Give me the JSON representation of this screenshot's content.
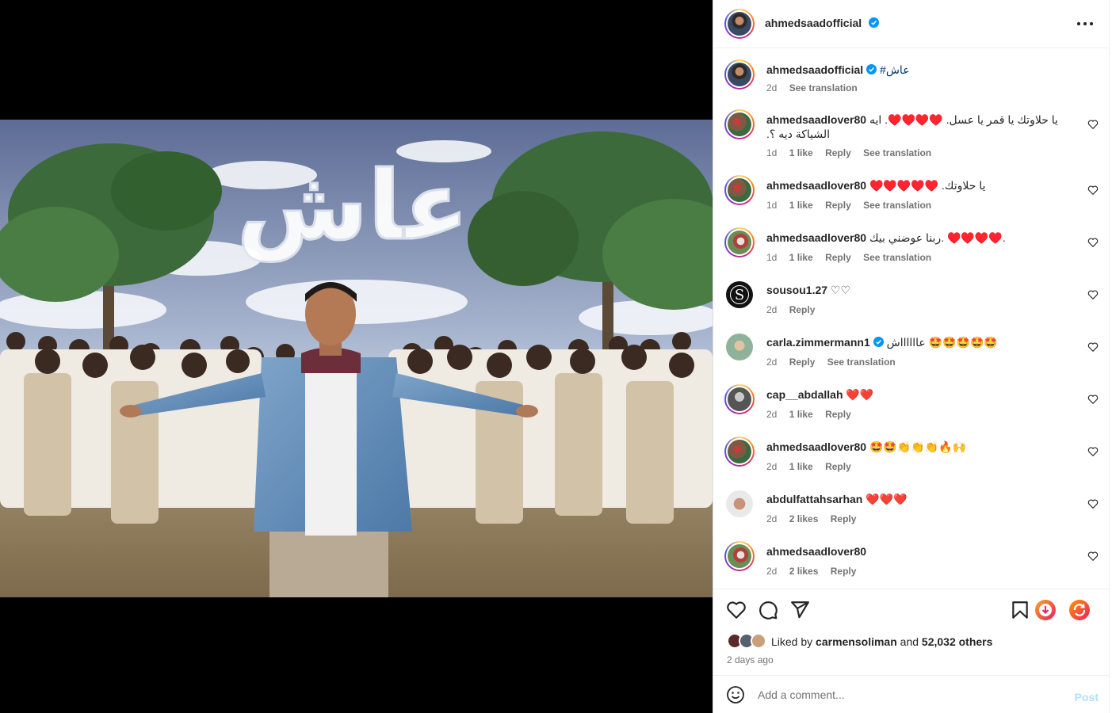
{
  "header": {
    "username": "ahmedsaadofficial",
    "more_icon": "more-horizontal-icon"
  },
  "caption": {
    "username": "ahmedsaadofficial",
    "text": "#عاش",
    "time": "2d",
    "see_translation": "See translation"
  },
  "media": {
    "cloud_text": "عاش"
  },
  "comments": [
    {
      "username": "ahmedsaadlover80",
      "text": "يا حلاوتك يا قمر يا عسل. ♥️♥️♥️♥️. ايه الشياكة ديه ؟.",
      "time": "1d",
      "likes": "1 like",
      "reply": "Reply",
      "translate": "See translation"
    },
    {
      "username": "ahmedsaadlover80",
      "text": "♥️♥️♥️♥️♥️ .يا حلاوتك",
      "time": "1d",
      "likes": "1 like",
      "reply": "Reply",
      "translate": "See translation"
    },
    {
      "username": "ahmedsaadlover80",
      "text": "ربنا عوضني بيك. ♥️♥️♥️♥️.",
      "time": "1d",
      "likes": "1 like",
      "reply": "Reply",
      "translate": "See translation"
    },
    {
      "username": "sousou1.27",
      "text": "♡♡",
      "time": "2d",
      "reply": "Reply"
    },
    {
      "username": "carla.zimmermann1",
      "text": "عااااااش 🤩🤩🤩🤩🤩",
      "time": "2d",
      "reply": "Reply",
      "translate": "See translation"
    },
    {
      "username": "cap__abdallah",
      "text": "❤️❤️",
      "time": "2d",
      "likes": "1 like",
      "reply": "Reply"
    },
    {
      "username": "ahmedsaadlover80",
      "text": "🤩🤩👏👏👏🔥🙌",
      "time": "2d",
      "likes": "1 like",
      "reply": "Reply"
    },
    {
      "username": "abdulfattahsarhan",
      "text": "❤️❤️❤️",
      "time": "2d",
      "likes": "2 likes",
      "reply": "Reply"
    },
    {
      "username": "ahmedsaadlover80",
      "text": "",
      "time": "2d",
      "likes": "2 likes",
      "reply": "Reply"
    }
  ],
  "likes": {
    "prefix": "Liked by",
    "first_user": "carmensoliman",
    "and": "and",
    "others": "52,032 others"
  },
  "time_ago": "2 days ago",
  "add_comment": {
    "placeholder": "Add a comment...",
    "post_label": "Post"
  },
  "colors": {
    "verified": "#0095f6",
    "heart_red": "#ed4956",
    "post_disabled": "#b2dffc"
  }
}
